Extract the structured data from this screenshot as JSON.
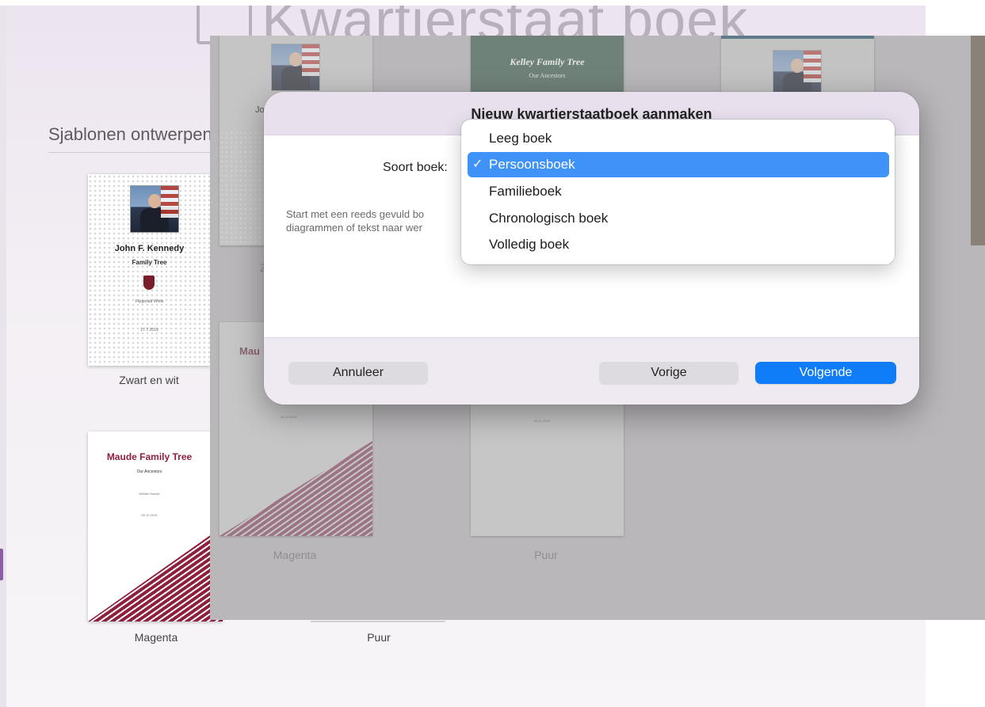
{
  "app_title": "Kwartierstaat boek",
  "section_title": "Sjablonen ontwerpen",
  "templates": [
    {
      "label": "Zwart en wit",
      "name": "John F. Kennedy",
      "subtitle": "Family Tree",
      "signature": "Fitzgerald White",
      "date": "17.7.2019"
    },
    {
      "label": "Magenta",
      "name": "Maude Family Tree",
      "subtitle": "Our Ancestors",
      "author": "William Maude",
      "date": "06.12.2019"
    },
    {
      "label": "Puur"
    }
  ],
  "background_templates": {
    "kelley_title": "Kelley Family Tree",
    "kelley_subtitle": "Our Ancestors",
    "jo_fragment": "Jo",
    "z_fragment": "Z",
    "mau_fragment": "Mau",
    "magenta_date": "06.12.2019",
    "puur_date": "05.11.2019",
    "magenta_label": "Magenta",
    "puur_label": "Puur"
  },
  "dialog": {
    "title": "Nieuw kwartierstaatboek aanmaken",
    "kind_label": "Soort boek:",
    "description_line1": "Start met een reeds gevuld bo",
    "description_line2": "diagrammen of tekst naar wer",
    "cancel_label": "Annuleer",
    "previous_label": "Vorige",
    "next_label": "Volgende"
  },
  "dropdown": {
    "options": [
      "Leeg boek",
      "Persoonsboek",
      "Familieboek",
      "Chronologisch boek",
      "Volledig boek"
    ],
    "selected_index": 1,
    "check_mark": "✓"
  },
  "colors": {
    "accent": "#0f7df8",
    "selection": "#3f92f7",
    "magenta": "#8e1f3e"
  }
}
